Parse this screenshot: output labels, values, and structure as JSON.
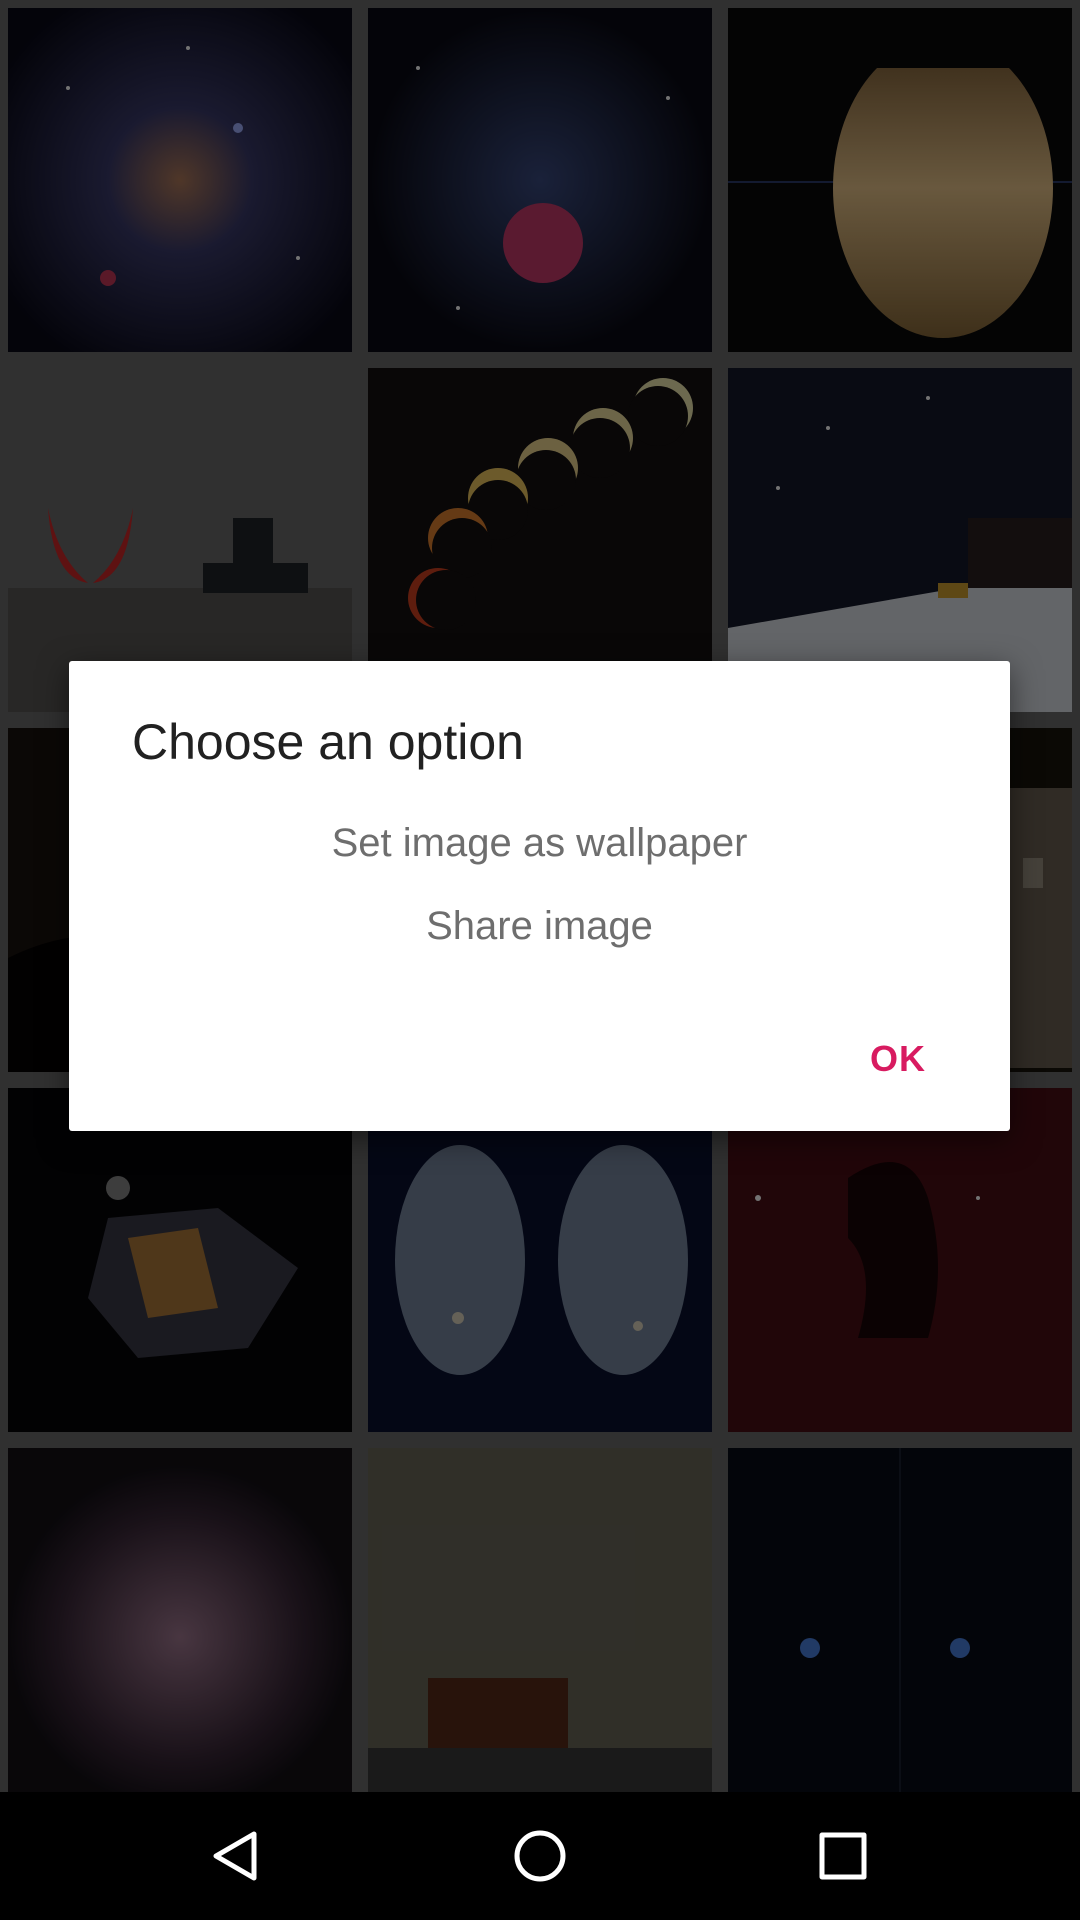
{
  "gallery": {
    "tiles": [
      {
        "icon": "galaxy-spiral-thumbnail"
      },
      {
        "icon": "nebula-red-thumbnail"
      },
      {
        "icon": "saturn-planet-thumbnail"
      },
      {
        "icon": "red-horns-ship-thumbnail"
      },
      {
        "icon": "eclipse-sequence-thumbnail"
      },
      {
        "icon": "milky-way-cabin-thumbnail"
      },
      {
        "icon": "dark-landscape-thumbnail"
      },
      {
        "icon": "blank-thumbnail"
      },
      {
        "icon": "building-night-thumbnail"
      },
      {
        "icon": "lunar-module-thumbnail"
      },
      {
        "icon": "twin-moons-thumbnail"
      },
      {
        "icon": "horsehead-nebula-thumbnail"
      },
      {
        "icon": "swirl-galaxy-thumbnail"
      },
      {
        "icon": "mammatus-clouds-thumbnail"
      },
      {
        "icon": "comet-comparison-thumbnail"
      }
    ]
  },
  "dialog": {
    "title": "Choose an option",
    "options": [
      "Set image as wallpaper",
      "Share image"
    ],
    "ok_label": "OK"
  },
  "navbar": {
    "back_icon": "back-triangle-icon",
    "home_icon": "home-circle-icon",
    "recents_icon": "recents-square-icon"
  },
  "colors": {
    "accent": "#d81b60",
    "navbar": "#000000",
    "dialog_bg": "#ffffff"
  }
}
